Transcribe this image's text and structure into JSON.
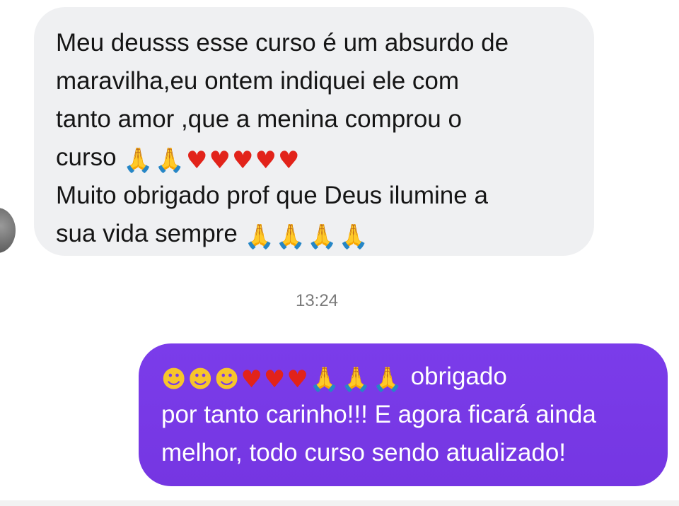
{
  "messages": {
    "incoming": {
      "line1": "Meu deusss esse curso é um absurdo de",
      "line2": "maravilha,eu ontem indiquei ele com",
      "line3": "tanto amor ,que a menina comprou o",
      "line4": "curso",
      "line5": "Muito obrigado prof que Deus ilumine a",
      "line6": "sua vida sempre",
      "line4_emojis": [
        "pray",
        "pray",
        "heart",
        "heart",
        "heart",
        "heart",
        "heart"
      ],
      "line6_emojis": [
        "pray",
        "pray",
        "pray",
        "pray"
      ]
    },
    "timestamp": "13:24",
    "outgoing": {
      "line1_emojis": [
        "heart-eyes",
        "heart-eyes",
        "heart-eyes",
        "heart",
        "heart",
        "heart",
        "pray",
        "pray",
        "pray"
      ],
      "line1": "obrigado",
      "line2": "por tanto carinho!!! E agora ficará ainda",
      "line3": "melhor, todo curso sendo atualizado!",
      "bubble_color": "#7a3ae8"
    }
  },
  "glyphs": {
    "pray": "🙏",
    "heart": "♥",
    "heart-eyes": "☻"
  },
  "colors": {
    "incoming_bubble": "#eff0f2",
    "outgoing_bubble": "#7a3ae8",
    "timestamp_text": "#7a7a7a"
  }
}
